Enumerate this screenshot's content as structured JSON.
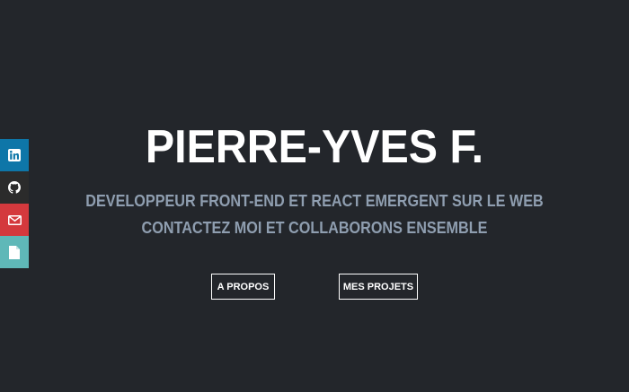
{
  "hero": {
    "title": "PIERRE-YVES F.",
    "subtitle_line1": "DEVELOPPEUR FRONT-END ET REACT EMERGENT SUR LE WEB",
    "subtitle_line2": "CONTACTEZ MOI ET COLLABORONS ENSEMBLE",
    "buttons": {
      "about_label": "A PROPOS",
      "projects_label": "MES PROJETS"
    }
  },
  "social": [
    {
      "icon": "linkedin-icon",
      "color": "#0e76a8"
    },
    {
      "icon": "github-icon",
      "color": "#2b2b2b"
    },
    {
      "icon": "mail-icon",
      "color": "#d4393d"
    },
    {
      "icon": "document-icon",
      "color": "#5fb8b8"
    }
  ],
  "colors": {
    "background": "#23262b",
    "title": "#ffffff",
    "subtitle": "#8f9eb0"
  }
}
